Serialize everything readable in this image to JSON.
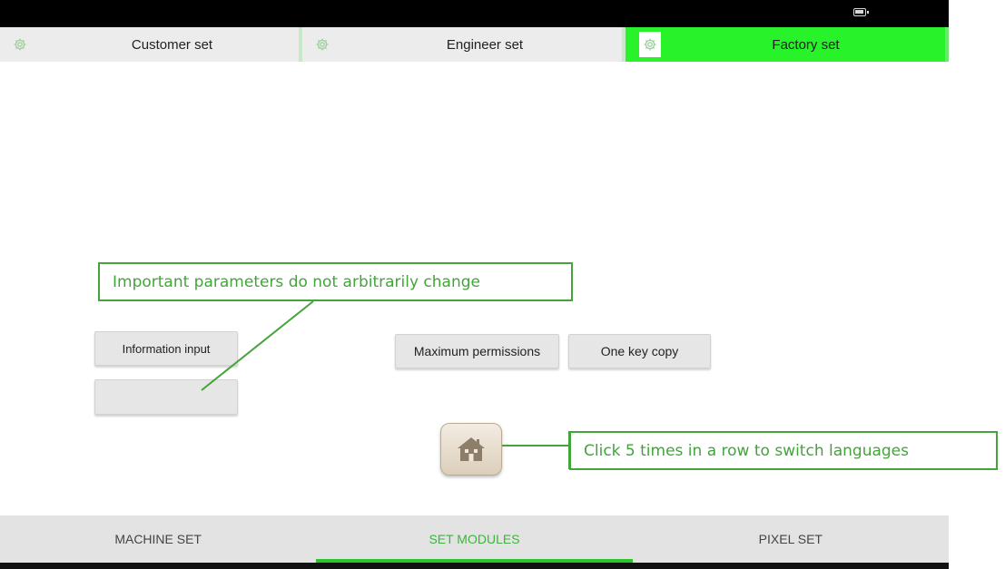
{
  "tabs": [
    {
      "label": "Customer set",
      "icon": "gear-icon",
      "active": false
    },
    {
      "label": "Engineer set",
      "icon": "gear-icon",
      "active": false
    },
    {
      "label": "Factory set",
      "icon": "gear-icon",
      "active": true
    }
  ],
  "buttons": {
    "information_input": "Information input",
    "blank": "",
    "maximum_permissions": "Maximum permissions",
    "one_key_copy": "One key copy"
  },
  "callouts": {
    "parameters": "Important parameters do not arbitrarily change",
    "languages": "Click 5 times in a row to switch languages"
  },
  "home_button": {
    "icon": "home-icon"
  },
  "bottom_nav": [
    {
      "label": "MACHINE SET",
      "active": false
    },
    {
      "label": "SET MODULES",
      "active": true
    },
    {
      "label": "PIXEL SET",
      "active": false
    }
  ],
  "colors": {
    "active_tab": "#27f22a",
    "accent_green": "#3bb53b",
    "callout": "#43a43a"
  }
}
